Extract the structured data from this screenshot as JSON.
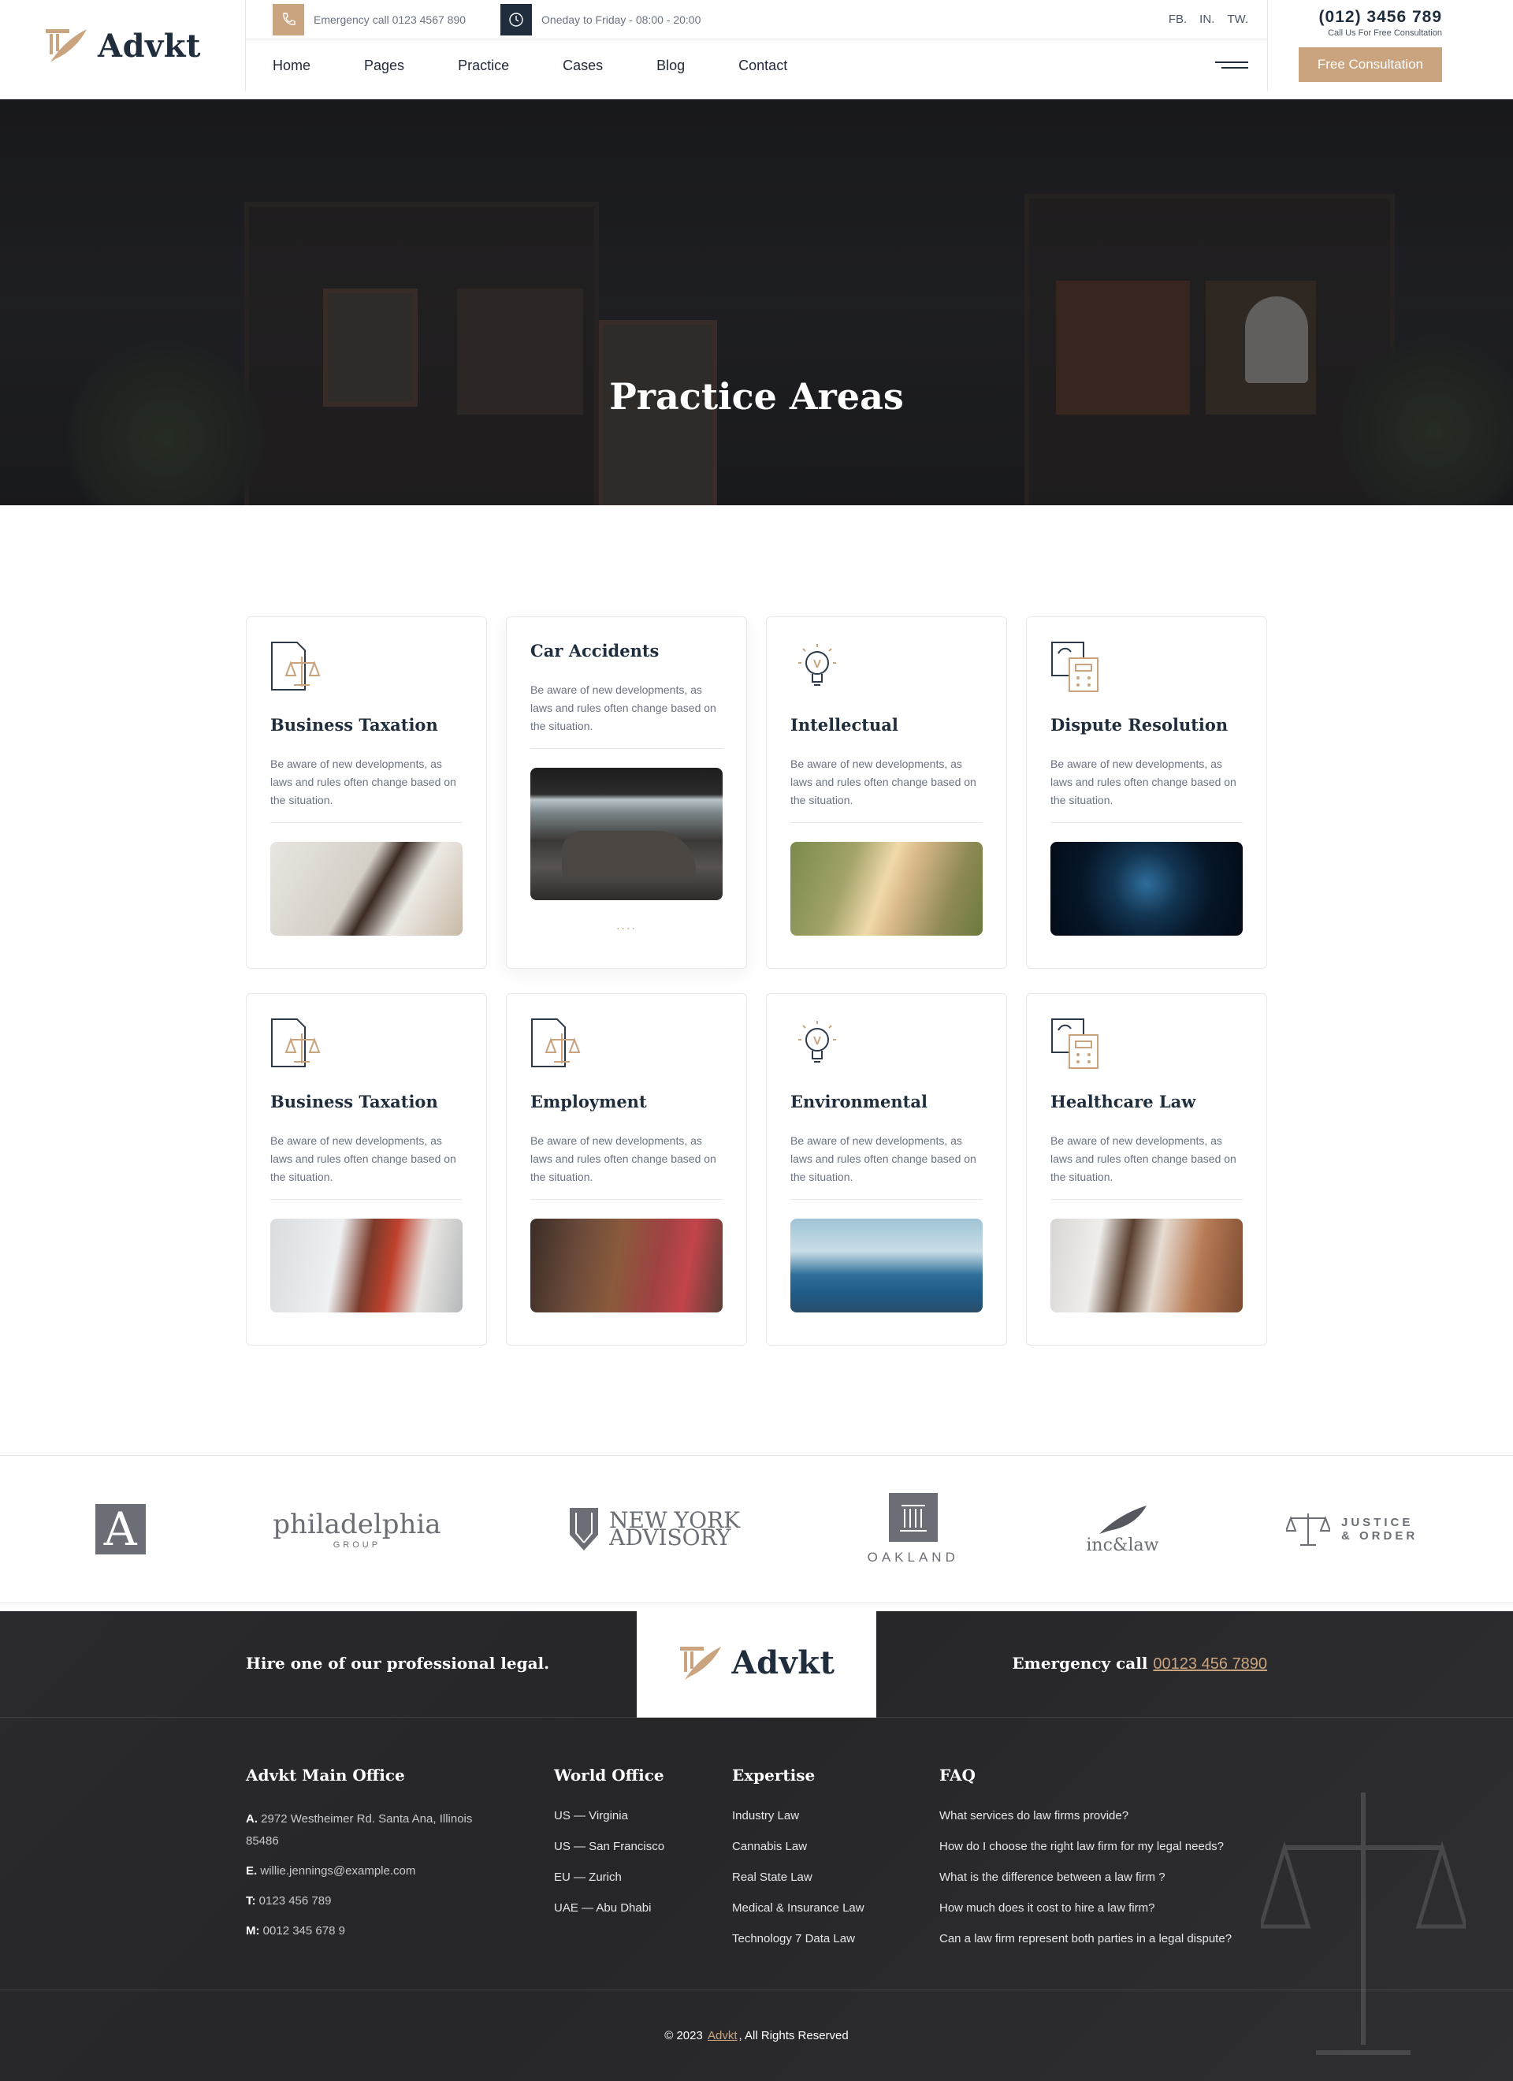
{
  "header": {
    "logo_text": "Advkt",
    "emergency_text": "Emergency call 0123 4567 890",
    "hours_text": "Oneday to Friday - 08:00 - 20:00",
    "socials": [
      "FB.",
      "IN.",
      "TW."
    ],
    "phone": "(012) 3456 789",
    "phone_sub": "Call Us For Free Consultation",
    "cta_label": "Free Consultation",
    "nav": [
      "Home",
      "Pages",
      "Practice",
      "Cases",
      "Blog",
      "Contact"
    ]
  },
  "hero": {
    "title": "Practice Areas"
  },
  "cards": [
    {
      "title": "Business Taxation",
      "text": "Be aware of new developments, as laws and rules often change based on the situation.",
      "icon": "scales-document-icon"
    },
    {
      "title": "Car Accidents",
      "text": "Be aware of new developments, as laws and rules often change based on the situation.",
      "icon": "none",
      "more": "...."
    },
    {
      "title": "Intellectual",
      "text": "Be aware of new developments, as laws and rules often change based on the situation.",
      "icon": "lightbulb-icon"
    },
    {
      "title": "Dispute Resolution",
      "text": "Be aware of new developments, as laws and rules often change based on the situation.",
      "icon": "calculator-document-icon"
    },
    {
      "title": "Business Taxation",
      "text": "Be aware of new developments, as laws and rules often change based on the situation.",
      "icon": "scales-document-icon"
    },
    {
      "title": "Employment",
      "text": "Be aware of new developments, as laws and rules often change based on the situation.",
      "icon": "scales-document-icon"
    },
    {
      "title": "Environmental",
      "text": "Be aware of new developments, as laws and rules often change based on the situation.",
      "icon": "lightbulb-icon"
    },
    {
      "title": "Healthcare Law",
      "text": "Be aware of new developments, as laws and rules often change based on the situation.",
      "icon": "calculator-document-icon"
    }
  ],
  "brands": [
    {
      "name": "A",
      "type": "letter-box"
    },
    {
      "name": "philadelphia",
      "sub": "GROUP"
    },
    {
      "name": "NEW YORK",
      "sub": "ADVISORY"
    },
    {
      "name": "OAKLAND"
    },
    {
      "name": "inc&law"
    },
    {
      "name": "JUSTICE",
      "sub": "& ORDER"
    }
  ],
  "footer": {
    "hire_text": "Hire one of our professional legal.",
    "logo_text": "Advkt",
    "emergency_label": "Emergency call",
    "emergency_number": "00123 456 7890",
    "office": {
      "title": "Advkt Main Office",
      "address_label": "A.",
      "address": "2972 Westheimer Rd. Santa Ana, Illinois 85486",
      "email_label": "E.",
      "email": "willie.jennings@example.com",
      "tel_label": "T:",
      "tel": "0123 456 789",
      "mobile_label": "M:",
      "mobile": "0012 345 678 9"
    },
    "world": {
      "title": "World Office",
      "items": [
        "US — Virginia",
        "US — San Francisco",
        "EU — Zurich",
        "UAE — Abu Dhabi"
      ]
    },
    "expertise": {
      "title": "Expertise",
      "items": [
        "Industry Law",
        "Cannabis Law",
        "Real State Law",
        "Medical & Insurance Law",
        "Technology 7 Data Law"
      ]
    },
    "faq": {
      "title": "FAQ",
      "items": [
        "What services do law firms provide?",
        "How do I choose the right law firm for my legal needs?",
        "What is the difference between a law firm ?",
        "How much does it cost to hire a law firm?",
        "Can a law firm represent both parties in a legal dispute?"
      ]
    },
    "copyright_prefix": "© 2023",
    "copyright_brand": "Advkt",
    "copyright_suffix": ", All Rights Reserved"
  },
  "colors": {
    "accent": "#c9a47e",
    "navy": "#1f2d3d",
    "footer_bg": "#2a2a2e"
  }
}
